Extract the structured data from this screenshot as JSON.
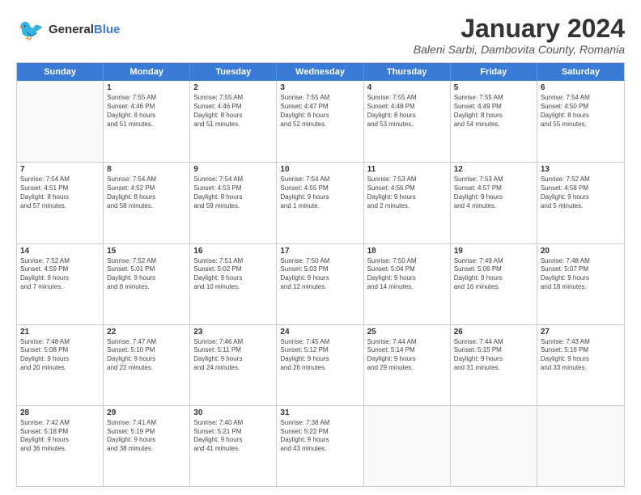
{
  "header": {
    "logo_general": "General",
    "logo_blue": "Blue",
    "month": "January 2024",
    "location": "Baleni Sarbi, Dambovita County, Romania"
  },
  "days_of_week": [
    "Sunday",
    "Monday",
    "Tuesday",
    "Wednesday",
    "Thursday",
    "Friday",
    "Saturday"
  ],
  "weeks": [
    [
      {
        "day": "",
        "lines": []
      },
      {
        "day": "1",
        "lines": [
          "Sunrise: 7:55 AM",
          "Sunset: 4:46 PM",
          "Daylight: 8 hours",
          "and 51 minutes."
        ]
      },
      {
        "day": "2",
        "lines": [
          "Sunrise: 7:55 AM",
          "Sunset: 4:46 PM",
          "Daylight: 8 hours",
          "and 51 minutes."
        ]
      },
      {
        "day": "3",
        "lines": [
          "Sunrise: 7:55 AM",
          "Sunset: 4:47 PM",
          "Daylight: 8 hours",
          "and 52 minutes."
        ]
      },
      {
        "day": "4",
        "lines": [
          "Sunrise: 7:55 AM",
          "Sunset: 4:48 PM",
          "Daylight: 8 hours",
          "and 53 minutes."
        ]
      },
      {
        "day": "5",
        "lines": [
          "Sunrise: 7:55 AM",
          "Sunset: 4:49 PM",
          "Daylight: 8 hours",
          "and 54 minutes."
        ]
      },
      {
        "day": "6",
        "lines": [
          "Sunrise: 7:54 AM",
          "Sunset: 4:50 PM",
          "Daylight: 8 hours",
          "and 55 minutes."
        ]
      }
    ],
    [
      {
        "day": "7",
        "lines": [
          "Sunrise: 7:54 AM",
          "Sunset: 4:51 PM",
          "Daylight: 8 hours",
          "and 57 minutes."
        ]
      },
      {
        "day": "8",
        "lines": [
          "Sunrise: 7:54 AM",
          "Sunset: 4:52 PM",
          "Daylight: 8 hours",
          "and 58 minutes."
        ]
      },
      {
        "day": "9",
        "lines": [
          "Sunrise: 7:54 AM",
          "Sunset: 4:53 PM",
          "Daylight: 8 hours",
          "and 59 minutes."
        ]
      },
      {
        "day": "10",
        "lines": [
          "Sunrise: 7:54 AM",
          "Sunset: 4:55 PM",
          "Daylight: 9 hours",
          "and 1 minute."
        ]
      },
      {
        "day": "11",
        "lines": [
          "Sunrise: 7:53 AM",
          "Sunset: 4:56 PM",
          "Daylight: 9 hours",
          "and 2 minutes."
        ]
      },
      {
        "day": "12",
        "lines": [
          "Sunrise: 7:53 AM",
          "Sunset: 4:57 PM",
          "Daylight: 9 hours",
          "and 4 minutes."
        ]
      },
      {
        "day": "13",
        "lines": [
          "Sunrise: 7:52 AM",
          "Sunset: 4:58 PM",
          "Daylight: 9 hours",
          "and 5 minutes."
        ]
      }
    ],
    [
      {
        "day": "14",
        "lines": [
          "Sunrise: 7:52 AM",
          "Sunset: 4:59 PM",
          "Daylight: 9 hours",
          "and 7 minutes."
        ]
      },
      {
        "day": "15",
        "lines": [
          "Sunrise: 7:52 AM",
          "Sunset: 5:01 PM",
          "Daylight: 9 hours",
          "and 8 minutes."
        ]
      },
      {
        "day": "16",
        "lines": [
          "Sunrise: 7:51 AM",
          "Sunset: 5:02 PM",
          "Daylight: 9 hours",
          "and 10 minutes."
        ]
      },
      {
        "day": "17",
        "lines": [
          "Sunrise: 7:50 AM",
          "Sunset: 5:03 PM",
          "Daylight: 9 hours",
          "and 12 minutes."
        ]
      },
      {
        "day": "18",
        "lines": [
          "Sunrise: 7:50 AM",
          "Sunset: 5:04 PM",
          "Daylight: 9 hours",
          "and 14 minutes."
        ]
      },
      {
        "day": "19",
        "lines": [
          "Sunrise: 7:49 AM",
          "Sunset: 5:06 PM",
          "Daylight: 9 hours",
          "and 16 minutes."
        ]
      },
      {
        "day": "20",
        "lines": [
          "Sunrise: 7:48 AM",
          "Sunset: 5:07 PM",
          "Daylight: 9 hours",
          "and 18 minutes."
        ]
      }
    ],
    [
      {
        "day": "21",
        "lines": [
          "Sunrise: 7:48 AM",
          "Sunset: 5:08 PM",
          "Daylight: 9 hours",
          "and 20 minutes."
        ]
      },
      {
        "day": "22",
        "lines": [
          "Sunrise: 7:47 AM",
          "Sunset: 5:10 PM",
          "Daylight: 9 hours",
          "and 22 minutes."
        ]
      },
      {
        "day": "23",
        "lines": [
          "Sunrise: 7:46 AM",
          "Sunset: 5:11 PM",
          "Daylight: 9 hours",
          "and 24 minutes."
        ]
      },
      {
        "day": "24",
        "lines": [
          "Sunrise: 7:45 AM",
          "Sunset: 5:12 PM",
          "Daylight: 9 hours",
          "and 26 minutes."
        ]
      },
      {
        "day": "25",
        "lines": [
          "Sunrise: 7:44 AM",
          "Sunset: 5:14 PM",
          "Daylight: 9 hours",
          "and 29 minutes."
        ]
      },
      {
        "day": "26",
        "lines": [
          "Sunrise: 7:44 AM",
          "Sunset: 5:15 PM",
          "Daylight: 9 hours",
          "and 31 minutes."
        ]
      },
      {
        "day": "27",
        "lines": [
          "Sunrise: 7:43 AM",
          "Sunset: 5:16 PM",
          "Daylight: 9 hours",
          "and 33 minutes."
        ]
      }
    ],
    [
      {
        "day": "28",
        "lines": [
          "Sunrise: 7:42 AM",
          "Sunset: 5:18 PM",
          "Daylight: 9 hours",
          "and 36 minutes."
        ]
      },
      {
        "day": "29",
        "lines": [
          "Sunrise: 7:41 AM",
          "Sunset: 5:19 PM",
          "Daylight: 9 hours",
          "and 38 minutes."
        ]
      },
      {
        "day": "30",
        "lines": [
          "Sunrise: 7:40 AM",
          "Sunset: 5:21 PM",
          "Daylight: 9 hours",
          "and 41 minutes."
        ]
      },
      {
        "day": "31",
        "lines": [
          "Sunrise: 7:38 AM",
          "Sunset: 5:22 PM",
          "Daylight: 9 hours",
          "and 43 minutes."
        ]
      },
      {
        "day": "",
        "lines": []
      },
      {
        "day": "",
        "lines": []
      },
      {
        "day": "",
        "lines": []
      }
    ]
  ]
}
